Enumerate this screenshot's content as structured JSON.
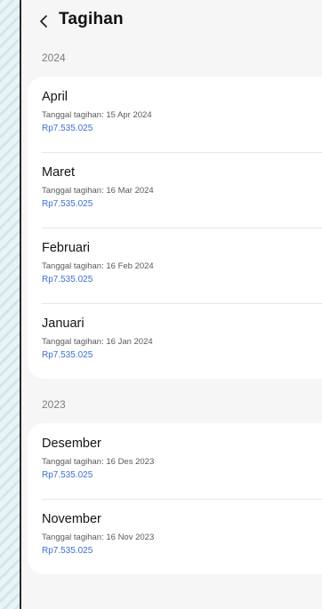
{
  "header": {
    "title": "Tagihan"
  },
  "sections": [
    {
      "year": "2024",
      "items": [
        {
          "month": "April",
          "date_text": "Tanggal tagihan: 15 Apr 2024",
          "amount": "Rp7.535.025"
        },
        {
          "month": "Maret",
          "date_text": "Tanggal tagihan: 16 Mar 2024",
          "amount": "Rp7.535.025"
        },
        {
          "month": "Februari",
          "date_text": "Tanggal tagihan: 16 Feb 2024",
          "amount": "Rp7.535.025"
        },
        {
          "month": "Januari",
          "date_text": "Tanggal tagihan: 16 Jan 2024",
          "amount": "Rp7.535.025"
        }
      ]
    },
    {
      "year": "2023",
      "items": [
        {
          "month": "Desember",
          "date_text": "Tanggal tagihan: 16 Des 2023",
          "amount": "Rp7.535.025"
        },
        {
          "month": "November",
          "date_text": "Tanggal tagihan: 16 Nov 2023",
          "amount": "Rp7.535.025"
        }
      ]
    }
  ],
  "icons": {
    "back": "chevron-left-icon"
  },
  "colors": {
    "amount": "#3d6fd6",
    "background": "#f6f6f7",
    "card": "#ffffff"
  }
}
